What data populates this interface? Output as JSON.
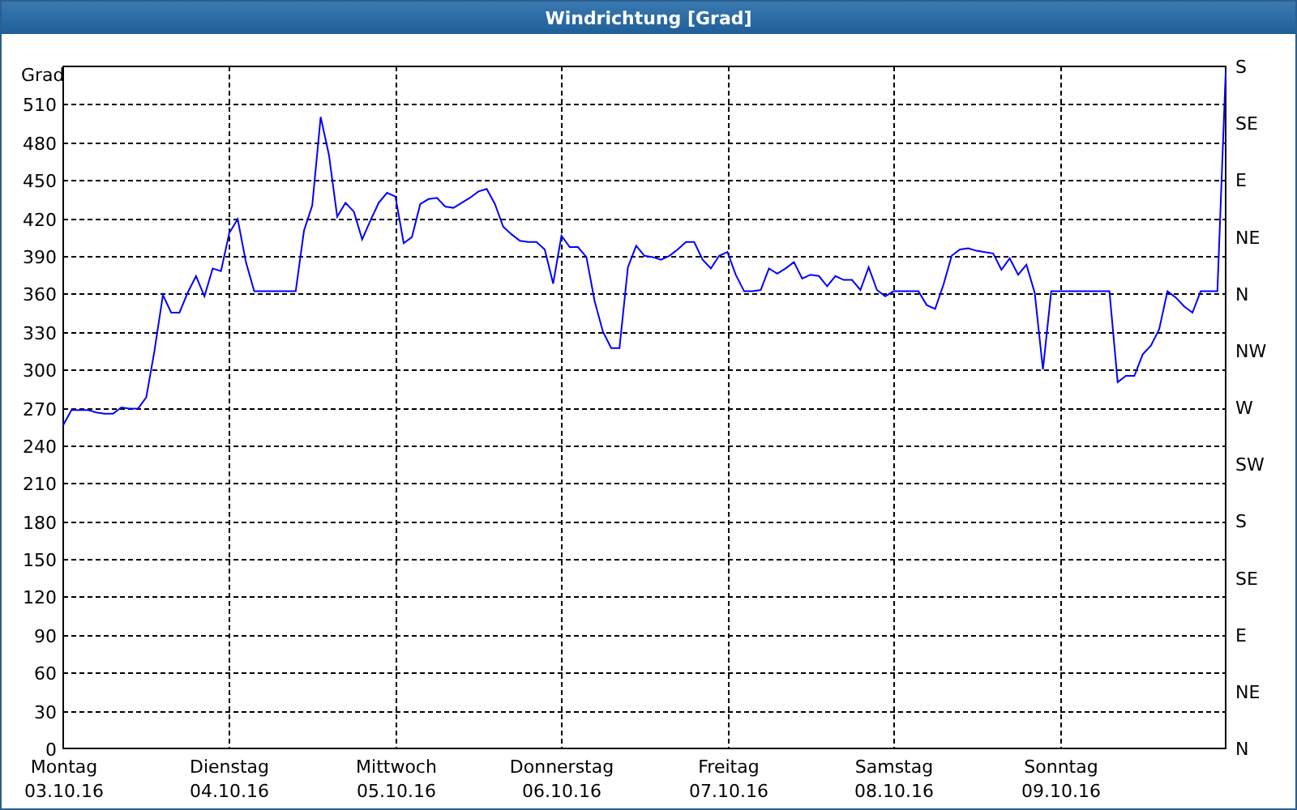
{
  "window": {
    "title": "Windrichtung [Grad]"
  },
  "chart": {
    "right_axis_labels": [
      "S",
      "SE",
      "E",
      "NE",
      "N",
      "NW",
      "W",
      "SW",
      "S",
      "SE",
      "E",
      "NE",
      "N"
    ],
    "chart_data": {
      "type": "line",
      "ylabel": "Grad",
      "ylim": [
        0,
        540
      ],
      "grid": true,
      "yticks": [
        0,
        30,
        60,
        90,
        120,
        150,
        180,
        210,
        240,
        270,
        300,
        330,
        360,
        390,
        420,
        450,
        480,
        510
      ],
      "categories": [
        "Montag\n03.10.16",
        null,
        null,
        null,
        null,
        null,
        null,
        null,
        null,
        null,
        null,
        null,
        null,
        null,
        null,
        null,
        null,
        null,
        null,
        null,
        "Dienstag\n04.10.16",
        null,
        null,
        null,
        null,
        null,
        null,
        null,
        null,
        null,
        null,
        null,
        null,
        null,
        null,
        null,
        null,
        null,
        null,
        null,
        "Mittwoch\n05.10.16",
        null,
        null,
        null,
        null,
        null,
        null,
        null,
        null,
        null,
        null,
        null,
        null,
        null,
        null,
        null,
        null,
        null,
        null,
        null,
        "Donnerstag\n06.10.16",
        null,
        null,
        null,
        null,
        null,
        null,
        null,
        null,
        null,
        null,
        null,
        null,
        null,
        null,
        null,
        null,
        null,
        null,
        null,
        "Freitag\n07.10.16",
        null,
        null,
        null,
        null,
        null,
        null,
        null,
        null,
        null,
        null,
        null,
        null,
        null,
        null,
        null,
        null,
        null,
        null,
        null,
        "Samstag\n08.10.16",
        null,
        null,
        null,
        null,
        null,
        null,
        null,
        null,
        null,
        null,
        null,
        null,
        null,
        null,
        null,
        null,
        null,
        null,
        null,
        "Sonntag\n09.10.16",
        null,
        null,
        null,
        null,
        null,
        null,
        null,
        null,
        null,
        null,
        null,
        null,
        null,
        null,
        null,
        null,
        null,
        null,
        null,
        null
      ],
      "series": [
        {
          "color": "#0000ff",
          "values": [
            256,
            268,
            268,
            268,
            266,
            265,
            265,
            270,
            269,
            269,
            278,
            315,
            359,
            345,
            345,
            361,
            374,
            358,
            380,
            378,
            408,
            419,
            385,
            362,
            362,
            362,
            362,
            362,
            362,
            410,
            430,
            500,
            470,
            421,
            432,
            425,
            403,
            418,
            432,
            440,
            437,
            400,
            405,
            431,
            435,
            436,
            429,
            428,
            432,
            436,
            441,
            443,
            431,
            413,
            407,
            402,
            401,
            401,
            395,
            368,
            406,
            397,
            397,
            389,
            354,
            330,
            317,
            317,
            381,
            398,
            390,
            389,
            387,
            390,
            395,
            401,
            401,
            387,
            380,
            390,
            393,
            375,
            362,
            362,
            363,
            380,
            376,
            380,
            385,
            372,
            375,
            374,
            366,
            374,
            371,
            371,
            363,
            381,
            363,
            358,
            362,
            362,
            362,
            362,
            351,
            348,
            367,
            390,
            395,
            396,
            394,
            393,
            392,
            379,
            388,
            375,
            383,
            361,
            300,
            362,
            362,
            362,
            362,
            362,
            362,
            362,
            362,
            290,
            295,
            295,
            312,
            319,
            332,
            362,
            357,
            350,
            345,
            362,
            362,
            362,
            535
          ]
        }
      ]
    }
  }
}
